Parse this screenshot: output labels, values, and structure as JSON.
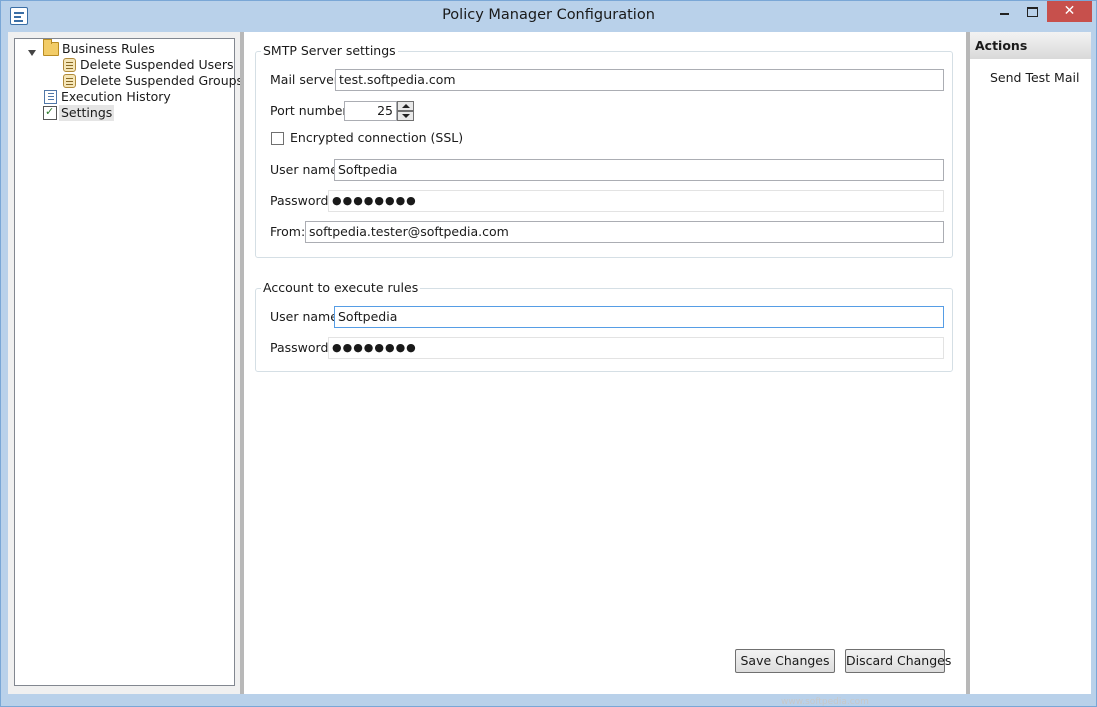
{
  "window": {
    "title": "Policy Manager Configuration",
    "close_glyph": "✕"
  },
  "tree": {
    "items": [
      {
        "label": "Business Rules",
        "icon": "folder-open-icon",
        "expanded": true
      },
      {
        "label": "Delete Suspended Users",
        "icon": "scroll-icon"
      },
      {
        "label": "Delete Suspended Groups",
        "icon": "scroll-icon"
      },
      {
        "label": "Execution History",
        "icon": "notebook-icon"
      },
      {
        "label": "Settings",
        "icon": "settings-icon",
        "selected": true
      }
    ]
  },
  "smtp": {
    "group_title": "SMTP Server settings",
    "mail_server_label": "Mail server:",
    "mail_server_value": "test.softpedia.com",
    "port_label": "Port number:",
    "port_value": "25",
    "ssl_label": "Encrypted connection (SSL)",
    "ssl_checked": false,
    "username_label": "User name:",
    "username_value": "Softpedia",
    "password_label": "Password:",
    "password_value": "●●●●●●●●",
    "from_label": "From:",
    "from_value": "softpedia.tester@softpedia.com"
  },
  "account": {
    "group_title": "Account to execute rules",
    "username_label": "User name:",
    "username_value": "Softpedia",
    "password_label": "Password:",
    "password_value": "●●●●●●●●"
  },
  "buttons": {
    "save": "Save Changes",
    "discard": "Discard Changes"
  },
  "actions": {
    "header": "Actions",
    "send_test_mail": "Send Test Mail"
  },
  "watermark": "www.softpedia.com",
  "colors": {
    "title_bg": "#b9d1ea",
    "close_bg": "#c7504c",
    "focus_border": "#569de5"
  }
}
